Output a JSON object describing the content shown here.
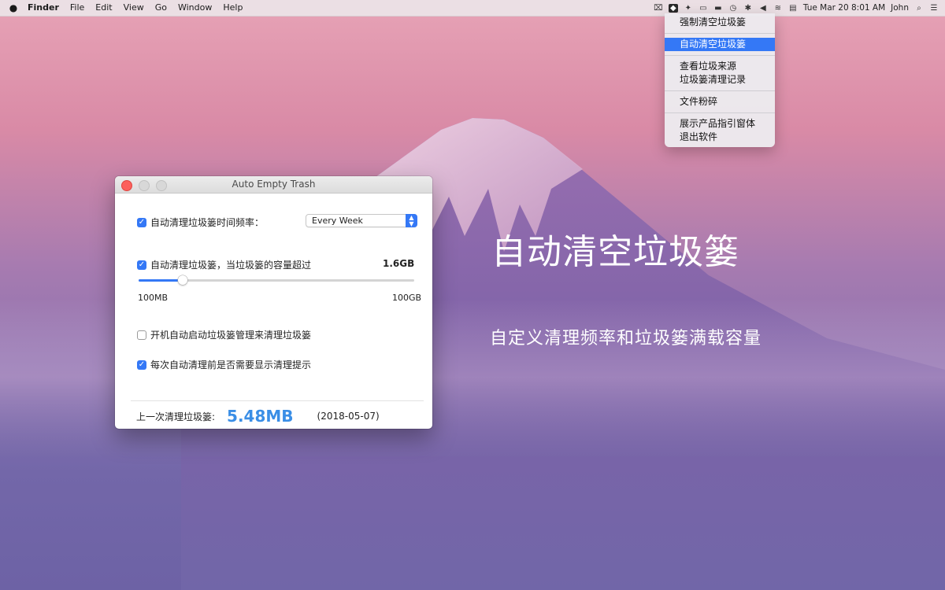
{
  "menubar": {
    "apple": "",
    "items": [
      "Finder",
      "File",
      "Edit",
      "View",
      "Go",
      "Window",
      "Help"
    ],
    "datetime": "Tue Mar 20  8:01 AM",
    "user": "John"
  },
  "dropdown": {
    "items": [
      {
        "label": "强制清空垃圾篓"
      },
      {
        "label": "自动清空垃圾篓",
        "selected": true
      },
      {
        "label": "查看垃圾来源"
      },
      {
        "label": "垃圾篓清理记录"
      },
      {
        "label": "文件粉碎"
      },
      {
        "label": "展示产品指引窗体"
      },
      {
        "label": "退出软件"
      }
    ]
  },
  "window": {
    "title": "Auto Empty Trash",
    "frequency": {
      "label": "自动清理垃圾篓时间频率：",
      "checked": true,
      "value": "Every Week"
    },
    "capacity": {
      "label": "自动清理垃圾篓，当垃圾篓的容量超过",
      "checked": true,
      "value": "1.6GB"
    },
    "slider": {
      "min_label": "100MB",
      "max_label": "100GB",
      "fraction": 0.16
    },
    "startup": {
      "label": "开机自动启动垃圾篓管理来清理垃圾篓",
      "checked": false
    },
    "prompt": {
      "label": "每次自动清理前是否需要显示清理提示",
      "checked": true
    },
    "last": {
      "label": "上一次清理垃圾篓:",
      "size": "5.48MB",
      "date": "(2018-05-07)"
    }
  },
  "overlay": {
    "title": "自动清空垃圾篓",
    "subtitle": "自定义清理频率和垃圾篓满载容量"
  },
  "colors": {
    "accent": "#3478f6",
    "value_blue": "#3a8ee6"
  }
}
